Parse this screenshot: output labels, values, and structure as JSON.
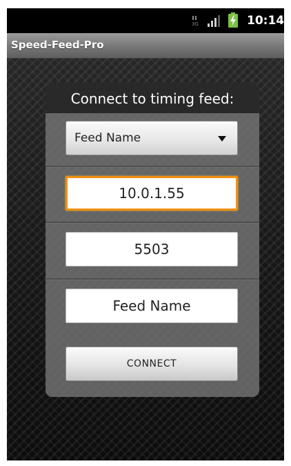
{
  "status_bar": {
    "time": "10:14",
    "network_icon": "3g-icon",
    "signal_icon": "signal-icon",
    "battery_icon": "battery-charging-icon"
  },
  "app": {
    "title": "Speed-Feed-Pro"
  },
  "panel": {
    "title": "Connect to timing feed:",
    "spinner": {
      "selected": "Feed Name",
      "icon": "dropdown-arrow-icon"
    },
    "host_field": {
      "value": "10.0.1.55"
    },
    "port_field": {
      "value": "5503"
    },
    "name_field": {
      "value": "Feed Name"
    },
    "connect_button": {
      "label": "CONNECT"
    }
  },
  "colors": {
    "focus_accent": "#f2910e",
    "battery_green": "#7ac143"
  }
}
